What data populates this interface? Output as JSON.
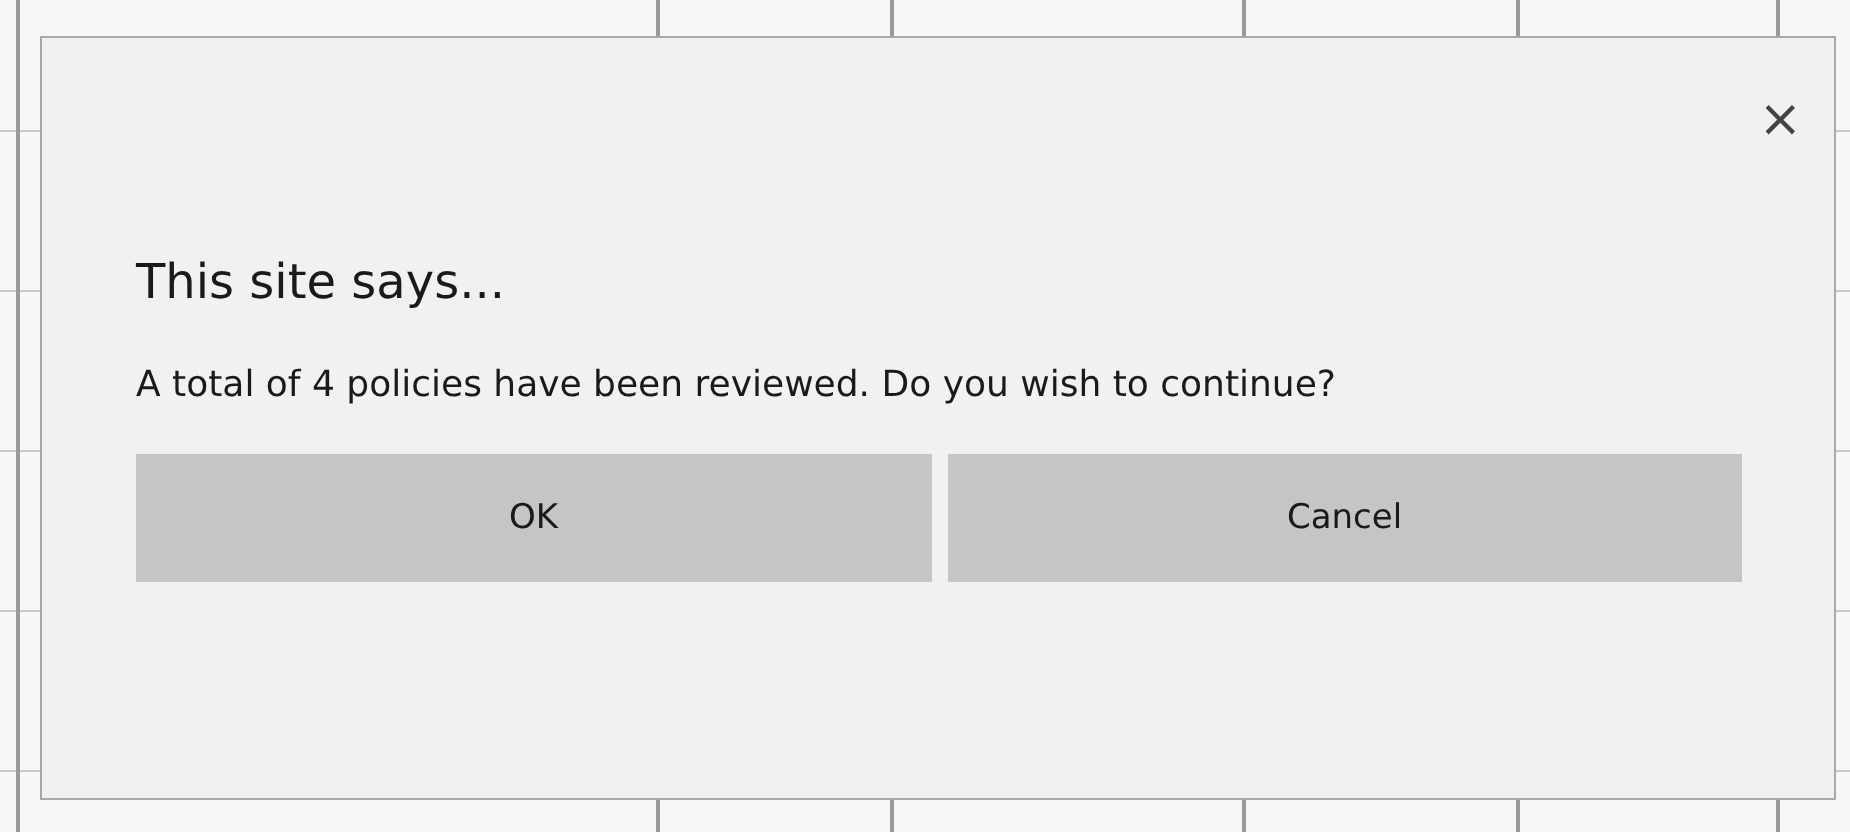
{
  "dialog": {
    "title": "This site says...",
    "message": "A total of 4 policies have been reviewed. Do you wish to continue?",
    "close": "×",
    "buttons": [
      {
        "label": "OK"
      },
      {
        "label": "Cancel"
      }
    ]
  }
}
